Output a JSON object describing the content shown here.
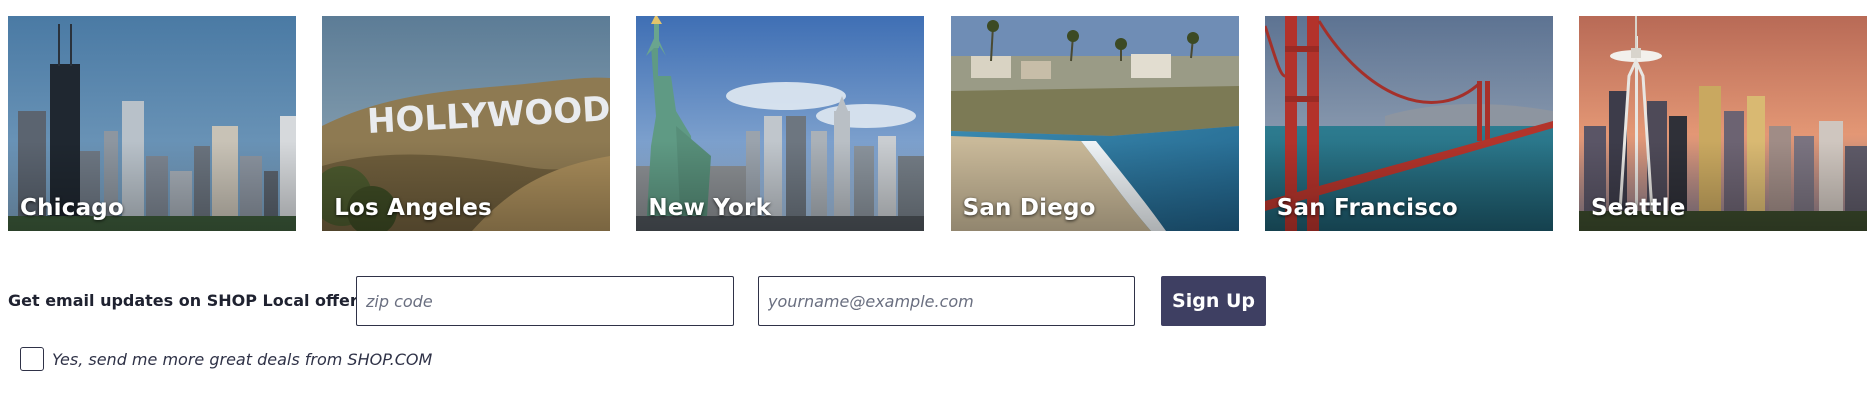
{
  "cities": [
    {
      "name": "Chicago",
      "image": "chicago-skyline"
    },
    {
      "name": "Los Angeles",
      "image": "hollywood-sign",
      "sign_text": "HOLLYWOOD"
    },
    {
      "name": "New York",
      "image": "statue-of-liberty"
    },
    {
      "name": "San Diego",
      "image": "san-diego-beach"
    },
    {
      "name": "San Francisco",
      "image": "golden-gate-bridge"
    },
    {
      "name": "Seattle",
      "image": "space-needle"
    }
  ],
  "signup": {
    "label": "Get email updates on SHOP Local offers in",
    "zip_placeholder": "zip code",
    "email_placeholder": "yourname@example.com",
    "button_label": "Sign Up",
    "button_color": "#3e3f62"
  },
  "optin": {
    "label": "Yes, send me more great deals from SHOP.COM",
    "checked": false
  }
}
